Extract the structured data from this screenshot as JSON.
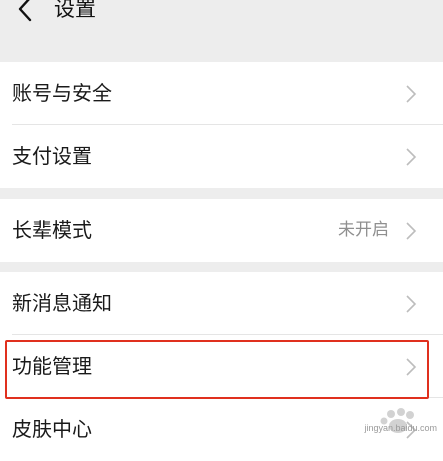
{
  "header": {
    "title": "设置",
    "back_icon": "chevron-left-icon"
  },
  "groups": [
    {
      "items": [
        {
          "label": "账号与安全"
        },
        {
          "label": "支付设置"
        }
      ]
    },
    {
      "items": [
        {
          "label": "长辈模式",
          "value": "未开启"
        }
      ]
    },
    {
      "items": [
        {
          "label": "新消息通知"
        },
        {
          "label": "功能管理",
          "highlighted": true
        },
        {
          "label": "皮肤中心"
        }
      ]
    }
  ],
  "colors": {
    "background": "#ededed",
    "card": "#ffffff",
    "text": "#1a1a1a",
    "secondary_text": "#8f8f8f",
    "chevron": "#bdbdbd",
    "highlight_border": "#e0301e"
  },
  "watermark": {
    "text": "jingyan.baidu.com"
  }
}
